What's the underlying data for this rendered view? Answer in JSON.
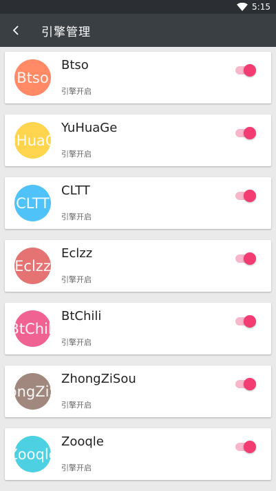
{
  "statusbar": {
    "time": "5:15",
    "wifi_icon": "wifi-icon"
  },
  "toolbar": {
    "back_icon": "chevron-left-icon",
    "title": "引擎管理"
  },
  "engines": [
    {
      "name": "Btso",
      "avatar_text": "Btso",
      "status": "引擎开启",
      "color": "#ff8a65",
      "enabled": true
    },
    {
      "name": "YuHuaGe",
      "avatar_text": "YuHuaGe",
      "status": "引擎开启",
      "color": "#ffd54f",
      "enabled": true
    },
    {
      "name": "CLTT",
      "avatar_text": "CLTT",
      "status": "引擎开启",
      "color": "#4fc3f7",
      "enabled": true
    },
    {
      "name": "Eclzz",
      "avatar_text": "Eclzz",
      "status": "引擎开启",
      "color": "#e57373",
      "enabled": true
    },
    {
      "name": "BtChili",
      "avatar_text": "BtChili",
      "status": "引擎开启",
      "color": "#f06292",
      "enabled": true
    },
    {
      "name": "ZhongZiSou",
      "avatar_text": "ZhongZiSou",
      "status": "引擎开启",
      "color": "#a1887f",
      "enabled": true
    },
    {
      "name": "Zooqle",
      "avatar_text": "Zooqle",
      "status": "引擎开启",
      "color": "#4dd0e1",
      "enabled": true
    }
  ],
  "switch_colors": {
    "track": "#f7b6c9",
    "thumb": "#f23c72"
  }
}
